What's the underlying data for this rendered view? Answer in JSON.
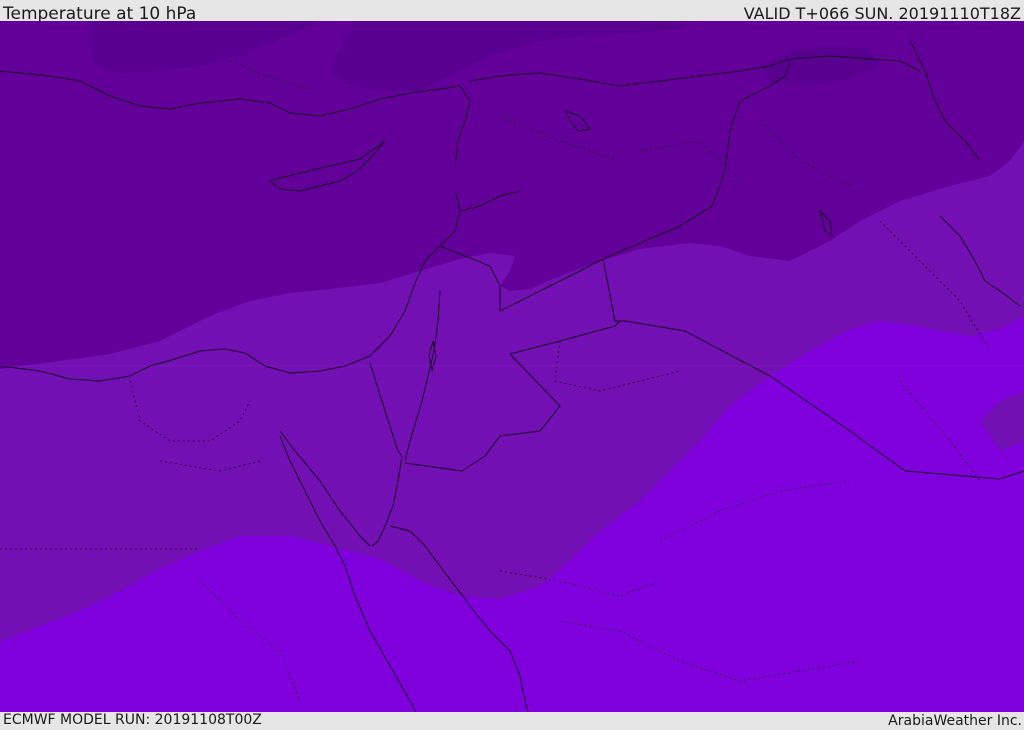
{
  "header": {
    "title": "Temperature at 10 hPa",
    "valid_time": "VALID T+066 SUN. 20191110T18Z"
  },
  "footer": {
    "model_run": "ECMWF MODEL RUN: 20191108T00Z",
    "credit": "ArabiaWeather Inc."
  },
  "map": {
    "field": "temperature",
    "level_hpa": 10,
    "colors": {
      "band_darkest": "#5a0090",
      "band_dark": "#64009a",
      "band_mid": "#7310b4",
      "band_bright": "#7f00dc",
      "coastline": "#1a0026",
      "border": "#1a0026"
    }
  }
}
